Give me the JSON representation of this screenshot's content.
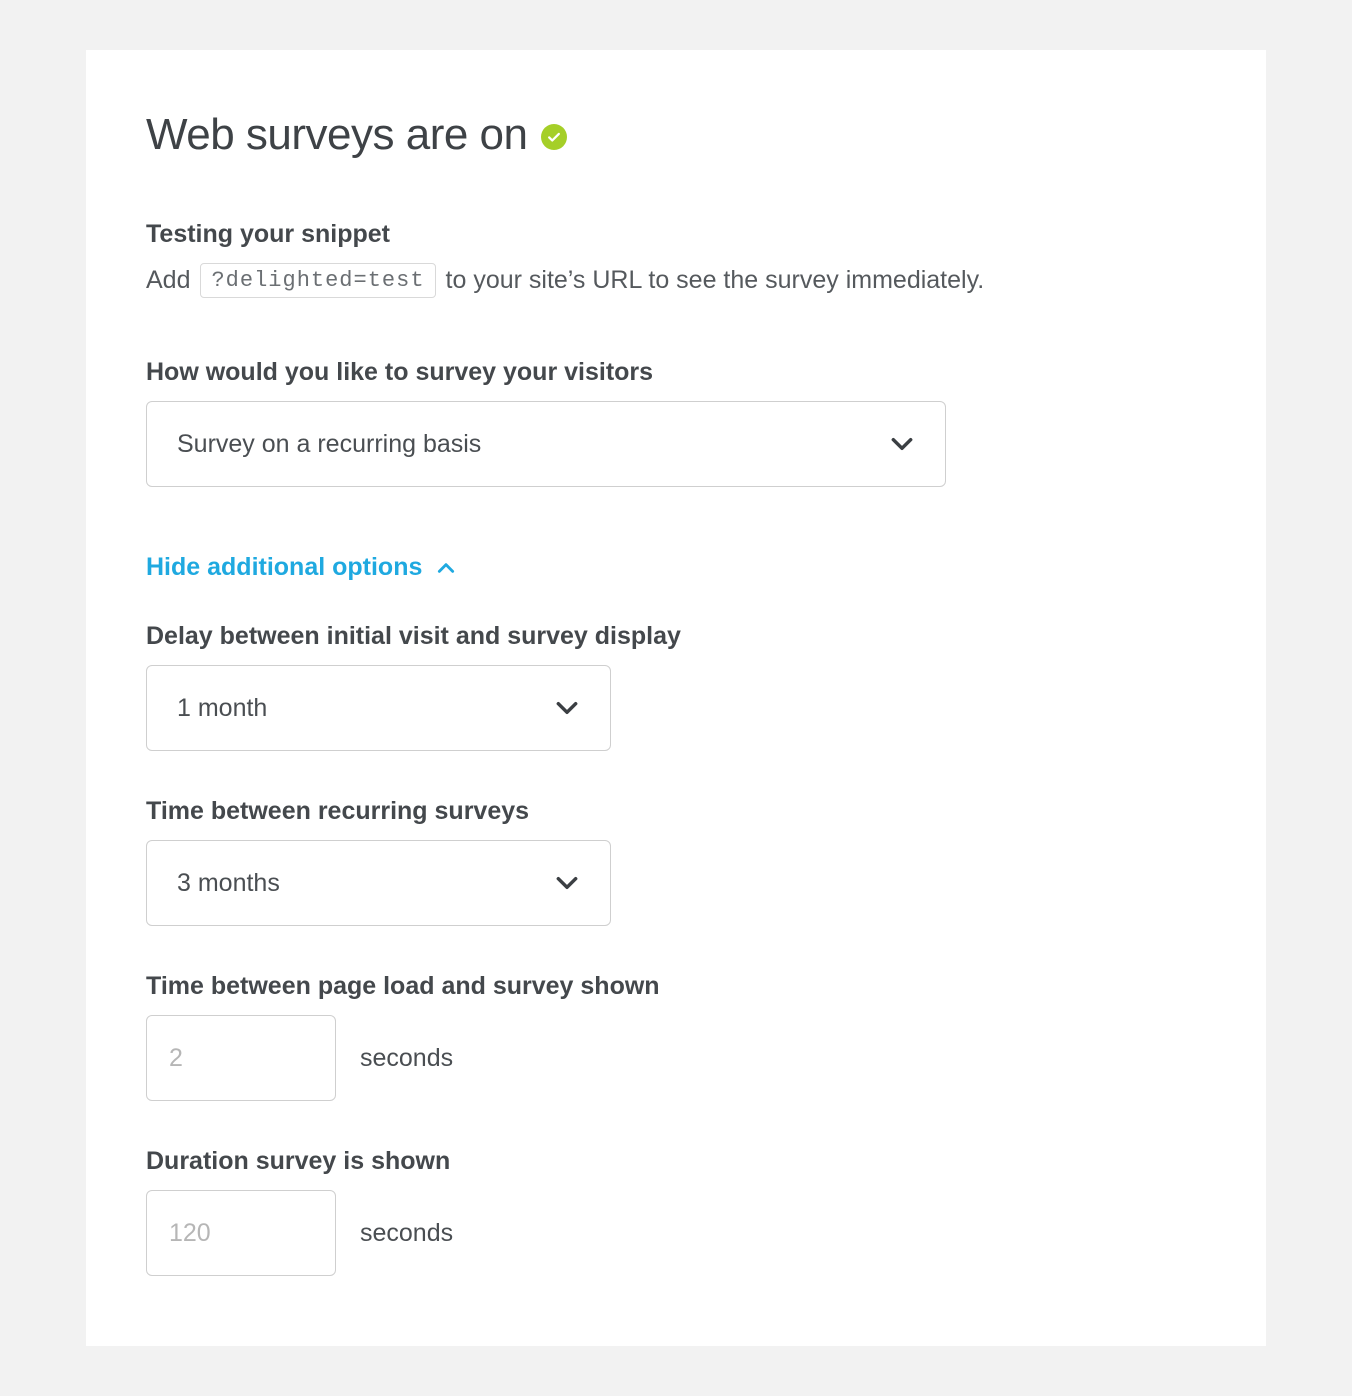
{
  "header": {
    "title": "Web surveys are on"
  },
  "testing": {
    "label": "Testing your snippet",
    "pre_text": "Add",
    "snippet": "?delighted=test",
    "post_text": "to your site’s URL to see the survey immediately."
  },
  "survey_mode": {
    "label": "How would you like to survey your visitors",
    "selected": "Survey on a recurring basis"
  },
  "toggle": {
    "label": "Hide additional options"
  },
  "delay_initial": {
    "label": "Delay between initial visit and survey display",
    "selected": "1 month"
  },
  "recurring_interval": {
    "label": "Time between recurring surveys",
    "selected": "3 months"
  },
  "page_load_delay": {
    "label": "Time between page load and survey shown",
    "placeholder": "2",
    "unit": "seconds"
  },
  "duration_shown": {
    "label": "Duration survey is shown",
    "placeholder": "120",
    "unit": "seconds"
  }
}
